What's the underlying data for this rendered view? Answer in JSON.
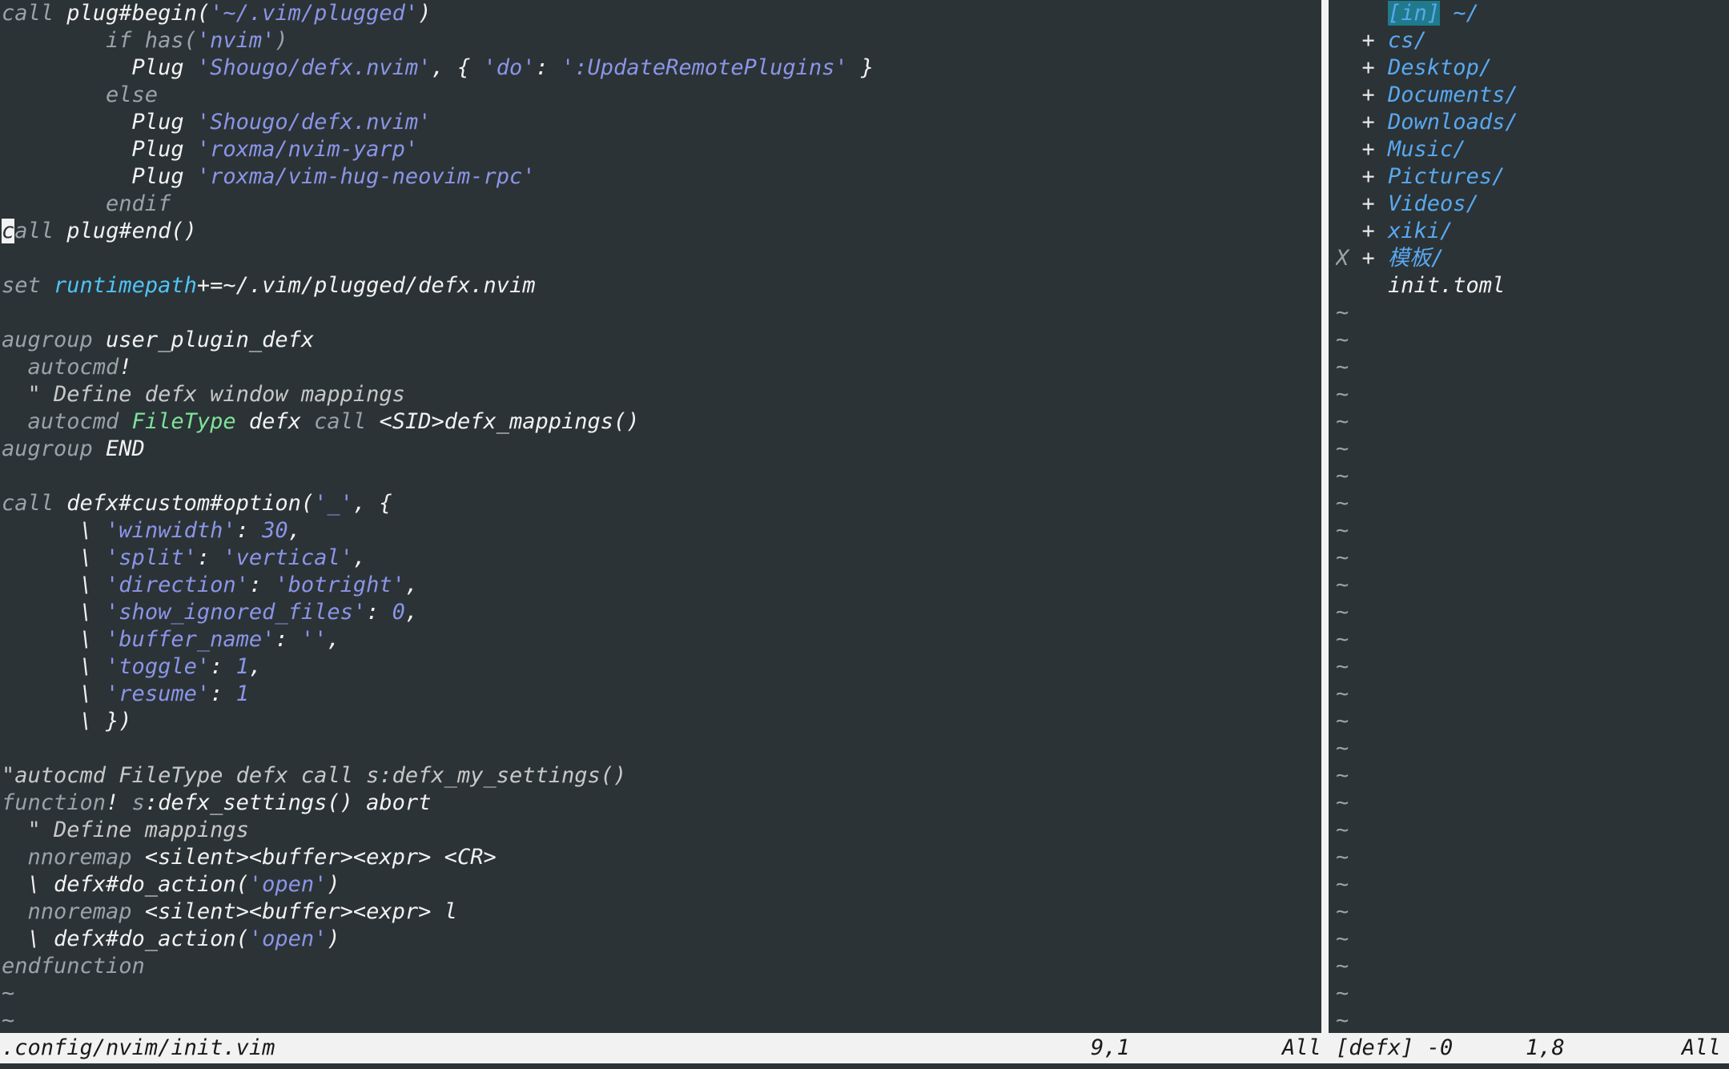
{
  "left_pane": {
    "lines": [
      {
        "parts": [
          [
            "kw",
            "call "
          ],
          [
            "fn",
            "plug#begin("
          ],
          [
            "str",
            "'~/.vim/plugged'"
          ],
          [
            "fn",
            ")"
          ]
        ]
      },
      {
        "parts": [
          [
            "kw",
            "        if has("
          ],
          [
            "str",
            "'nvim'"
          ],
          [
            "kw",
            ")"
          ]
        ]
      },
      {
        "parts": [
          [
            "fn",
            "          Plug "
          ],
          [
            "str",
            "'Shougo/defx.nvim'"
          ],
          [
            "fn",
            ", { "
          ],
          [
            "str",
            "'do'"
          ],
          [
            "fn",
            ": "
          ],
          [
            "str",
            "':UpdateRemotePlugins'"
          ],
          [
            "fn",
            " }"
          ]
        ]
      },
      {
        "parts": [
          [
            "kw",
            "        else"
          ]
        ]
      },
      {
        "parts": [
          [
            "fn",
            "          Plug "
          ],
          [
            "str",
            "'Shougo/defx.nvim'"
          ]
        ]
      },
      {
        "parts": [
          [
            "fn",
            "          Plug "
          ],
          [
            "str",
            "'roxma/nvim-yarp'"
          ]
        ]
      },
      {
        "parts": [
          [
            "fn",
            "          Plug "
          ],
          [
            "str",
            "'roxma/vim-hug-neovim-rpc'"
          ]
        ]
      },
      {
        "parts": [
          [
            "kw",
            "        endif"
          ]
        ]
      },
      {
        "parts": [
          [
            "cursor",
            "c"
          ],
          [
            "kw",
            "all "
          ],
          [
            "fn",
            "plug#end()"
          ]
        ]
      },
      {
        "parts": []
      },
      {
        "parts": [
          [
            "kw",
            "set "
          ],
          [
            "var",
            "runtimepath"
          ],
          [
            "fn",
            "+=~/.vim/plugged/defx.nvim"
          ]
        ]
      },
      {
        "parts": []
      },
      {
        "parts": [
          [
            "kw",
            "augroup "
          ],
          [
            "fn",
            "user_plugin_defx"
          ]
        ]
      },
      {
        "parts": [
          [
            "kw",
            "  autocmd"
          ],
          [
            "fn",
            "!"
          ]
        ]
      },
      {
        "parts": [
          [
            "cm",
            "  \" Define defx window mappings"
          ]
        ]
      },
      {
        "parts": [
          [
            "kw",
            "  autocmd "
          ],
          [
            "ft",
            "FileType"
          ],
          [
            "fn",
            " defx "
          ],
          [
            "kw",
            "call "
          ],
          [
            "fn",
            "<SID>defx_mappings()"
          ]
        ]
      },
      {
        "parts": [
          [
            "kw",
            "augroup "
          ],
          [
            "fn",
            "END"
          ]
        ]
      },
      {
        "parts": []
      },
      {
        "parts": [
          [
            "kw",
            "call "
          ],
          [
            "fn",
            "defx#custom#option("
          ],
          [
            "str",
            "'_'"
          ],
          [
            "fn",
            ", {"
          ]
        ]
      },
      {
        "parts": [
          [
            "fn",
            "      \\ "
          ],
          [
            "str",
            "'winwidth'"
          ],
          [
            "fn",
            ": "
          ],
          [
            "num",
            "30"
          ],
          [
            "fn",
            ","
          ]
        ]
      },
      {
        "parts": [
          [
            "fn",
            "      \\ "
          ],
          [
            "str",
            "'split'"
          ],
          [
            "fn",
            ": "
          ],
          [
            "str",
            "'vertical'"
          ],
          [
            "fn",
            ","
          ]
        ]
      },
      {
        "parts": [
          [
            "fn",
            "      \\ "
          ],
          [
            "str",
            "'direction'"
          ],
          [
            "fn",
            ": "
          ],
          [
            "str",
            "'botright'"
          ],
          [
            "fn",
            ","
          ]
        ]
      },
      {
        "parts": [
          [
            "fn",
            "      \\ "
          ],
          [
            "str",
            "'show_ignored_files'"
          ],
          [
            "fn",
            ": "
          ],
          [
            "num",
            "0"
          ],
          [
            "fn",
            ","
          ]
        ]
      },
      {
        "parts": [
          [
            "fn",
            "      \\ "
          ],
          [
            "str",
            "'buffer_name'"
          ],
          [
            "fn",
            ": "
          ],
          [
            "str",
            "''"
          ],
          [
            "fn",
            ","
          ]
        ]
      },
      {
        "parts": [
          [
            "fn",
            "      \\ "
          ],
          [
            "str",
            "'toggle'"
          ],
          [
            "fn",
            ": "
          ],
          [
            "num",
            "1"
          ],
          [
            "fn",
            ","
          ]
        ]
      },
      {
        "parts": [
          [
            "fn",
            "      \\ "
          ],
          [
            "str",
            "'resume'"
          ],
          [
            "fn",
            ": "
          ],
          [
            "num",
            "1"
          ]
        ]
      },
      {
        "parts": [
          [
            "fn",
            "      \\ })"
          ]
        ]
      },
      {
        "parts": []
      },
      {
        "parts": [
          [
            "cm",
            "\"autocmd FileType defx call s:defx_my_settings()"
          ]
        ]
      },
      {
        "parts": [
          [
            "kw",
            "function"
          ],
          [
            "fn",
            "! "
          ],
          [
            "kw",
            "s"
          ],
          [
            "fn",
            ":defx_settings() abort"
          ]
        ]
      },
      {
        "parts": [
          [
            "cm",
            "  \" Define mappings"
          ]
        ]
      },
      {
        "parts": [
          [
            "kw",
            "  nnoremap "
          ],
          [
            "fn",
            "<silent><buffer><expr> <CR>"
          ]
        ]
      },
      {
        "parts": [
          [
            "fn",
            "  \\ defx#do_action("
          ],
          [
            "str",
            "'open'"
          ],
          [
            "fn",
            ")"
          ]
        ]
      },
      {
        "parts": [
          [
            "kw",
            "  nnoremap "
          ],
          [
            "fn",
            "<silent><buffer><expr> l"
          ]
        ]
      },
      {
        "parts": [
          [
            "fn",
            "  \\ defx#do_action("
          ],
          [
            "str",
            "'open'"
          ],
          [
            "fn",
            ")"
          ]
        ]
      },
      {
        "parts": [
          [
            "kw",
            "endfunction"
          ]
        ]
      },
      {
        "parts": [
          [
            "tilde",
            "~"
          ]
        ]
      },
      {
        "parts": [
          [
            "tilde",
            "~"
          ]
        ]
      }
    ]
  },
  "right_pane": {
    "lines": [
      {
        "parts": [
          [
            "fn",
            "    "
          ],
          [
            "hl",
            "[in]"
          ],
          [
            "dir",
            " ~/"
          ]
        ]
      },
      {
        "parts": [
          [
            "plus",
            "  + "
          ],
          [
            "dir",
            "cs/"
          ]
        ]
      },
      {
        "parts": [
          [
            "plus",
            "  + "
          ],
          [
            "dir",
            "Desktop/"
          ]
        ]
      },
      {
        "parts": [
          [
            "plus",
            "  + "
          ],
          [
            "dir",
            "Documents/"
          ]
        ]
      },
      {
        "parts": [
          [
            "plus",
            "  + "
          ],
          [
            "dir",
            "Downloads/"
          ]
        ]
      },
      {
        "parts": [
          [
            "plus",
            "  + "
          ],
          [
            "dir",
            "Music/"
          ]
        ]
      },
      {
        "parts": [
          [
            "plus",
            "  + "
          ],
          [
            "dir",
            "Pictures/"
          ]
        ]
      },
      {
        "parts": [
          [
            "plus",
            "  + "
          ],
          [
            "dir",
            "Videos/"
          ]
        ]
      },
      {
        "parts": [
          [
            "plus",
            "  + "
          ],
          [
            "dir",
            "xiki/"
          ]
        ]
      },
      {
        "parts": [
          [
            "dim",
            "X "
          ],
          [
            "plus",
            "+ "
          ],
          [
            "dir",
            "模板/"
          ]
        ]
      },
      {
        "parts": [
          [
            "fn",
            "    init.toml"
          ]
        ]
      },
      {
        "parts": [
          [
            "tilde",
            "~"
          ]
        ]
      },
      {
        "parts": [
          [
            "tilde",
            "~"
          ]
        ]
      },
      {
        "parts": [
          [
            "tilde",
            "~"
          ]
        ]
      },
      {
        "parts": [
          [
            "tilde",
            "~"
          ]
        ]
      },
      {
        "parts": [
          [
            "tilde",
            "~"
          ]
        ]
      },
      {
        "parts": [
          [
            "tilde",
            "~"
          ]
        ]
      },
      {
        "parts": [
          [
            "tilde",
            "~"
          ]
        ]
      },
      {
        "parts": [
          [
            "tilde",
            "~"
          ]
        ]
      },
      {
        "parts": [
          [
            "tilde",
            "~"
          ]
        ]
      },
      {
        "parts": [
          [
            "tilde",
            "~"
          ]
        ]
      },
      {
        "parts": [
          [
            "tilde",
            "~"
          ]
        ]
      },
      {
        "parts": [
          [
            "tilde",
            "~"
          ]
        ]
      },
      {
        "parts": [
          [
            "tilde",
            "~"
          ]
        ]
      },
      {
        "parts": [
          [
            "tilde",
            "~"
          ]
        ]
      },
      {
        "parts": [
          [
            "tilde",
            "~"
          ]
        ]
      },
      {
        "parts": [
          [
            "tilde",
            "~"
          ]
        ]
      },
      {
        "parts": [
          [
            "tilde",
            "~"
          ]
        ]
      },
      {
        "parts": [
          [
            "tilde",
            "~"
          ]
        ]
      },
      {
        "parts": [
          [
            "tilde",
            "~"
          ]
        ]
      },
      {
        "parts": [
          [
            "tilde",
            "~"
          ]
        ]
      },
      {
        "parts": [
          [
            "tilde",
            "~"
          ]
        ]
      },
      {
        "parts": [
          [
            "tilde",
            "~"
          ]
        ]
      },
      {
        "parts": [
          [
            "tilde",
            "~"
          ]
        ]
      },
      {
        "parts": [
          [
            "tilde",
            "~"
          ]
        ]
      },
      {
        "parts": [
          [
            "tilde",
            "~"
          ]
        ]
      },
      {
        "parts": [
          [
            "tilde",
            "~"
          ]
        ]
      },
      {
        "parts": [
          [
            "tilde",
            "~"
          ]
        ]
      }
    ]
  },
  "statusbar": {
    "left_filename": ".config/nvim/init.vim",
    "left_position": "9,1",
    "left_scroll": "All",
    "right_buffer": "[defx] -0",
    "right_position": "1,8",
    "right_scroll": "All"
  }
}
